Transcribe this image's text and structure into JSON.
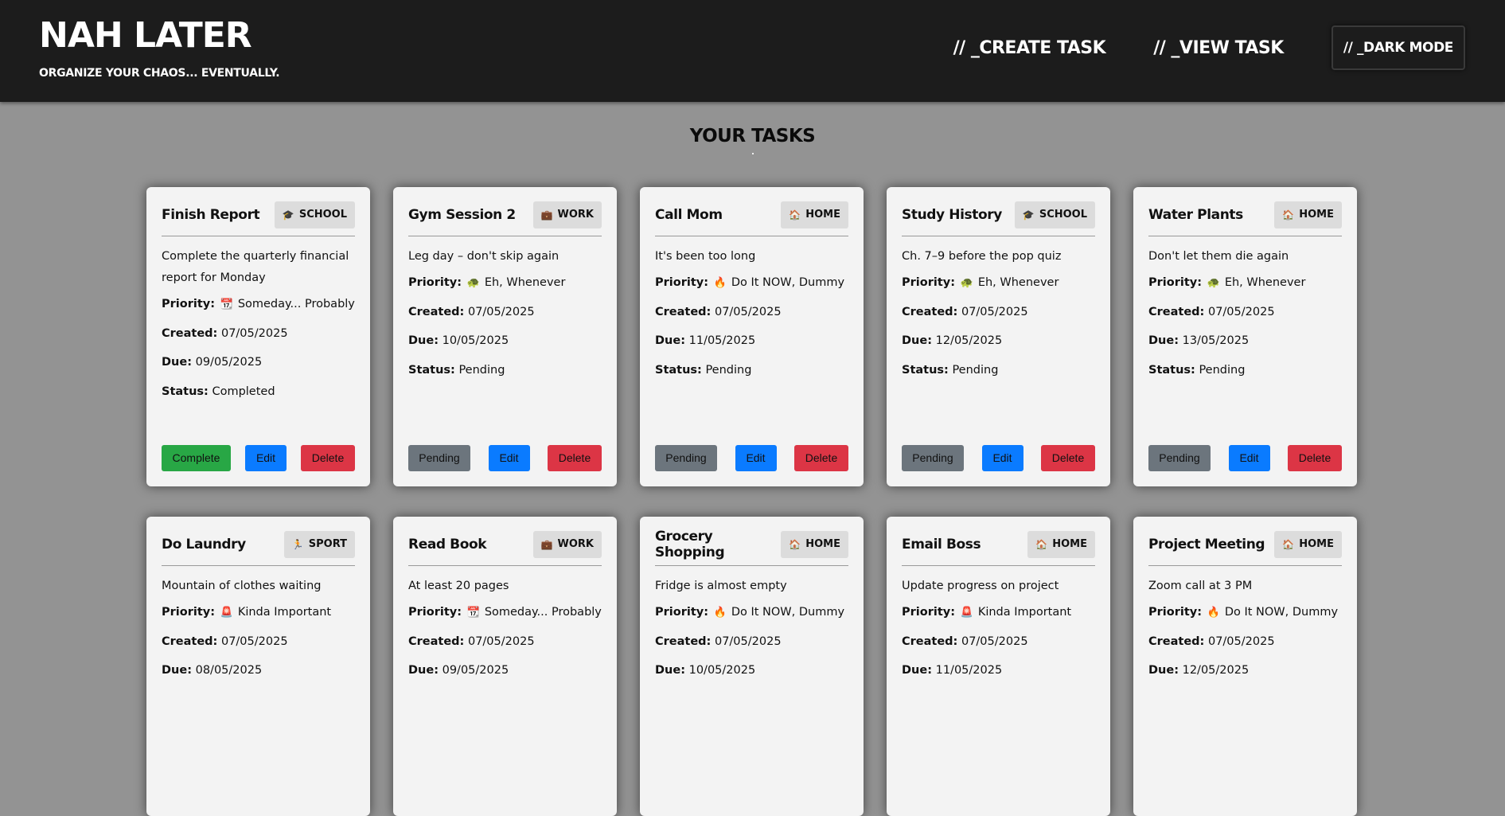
{
  "header": {
    "title": "NAH LATER",
    "tagline": "ORGANIZE YOUR CHAOS... EVENTUALLY.",
    "nav": {
      "create": "// _CREATE TASK",
      "view": "// _VIEW TASK",
      "dark": "// _DARK MODE"
    }
  },
  "main": {
    "heading": "YOUR TASKS"
  },
  "labels": {
    "priority": "Priority:",
    "created": "Created:",
    "due": "Due:",
    "status": "Status:",
    "edit": "Edit",
    "delete": "Delete"
  },
  "tasks": [
    {
      "title": "Finish Report",
      "category": "SCHOOL",
      "category_icon": "🎓",
      "description": "Complete the quarterly financial report for Monday",
      "priority_icon": "📆",
      "priority": "Someday... Probably",
      "created": "07/05/2025",
      "due": "09/05/2025",
      "status": "Completed",
      "status_button": "Complete",
      "done": true
    },
    {
      "title": "Gym Session 2",
      "category": "WORK",
      "category_icon": "💼",
      "description": "Leg day – don't skip again",
      "priority_icon": "🐢",
      "priority": "Eh, Whenever",
      "created": "07/05/2025",
      "due": "10/05/2025",
      "status": "Pending",
      "status_button": "Pending",
      "done": false
    },
    {
      "title": "Call Mom",
      "category": "HOME",
      "category_icon": "🏠",
      "description": "It's been too long",
      "priority_icon": "🔥",
      "priority": "Do It NOW, Dummy",
      "created": "07/05/2025",
      "due": "11/05/2025",
      "status": "Pending",
      "status_button": "Pending",
      "done": false
    },
    {
      "title": "Study History",
      "category": "SCHOOL",
      "category_icon": "🎓",
      "description": "Ch. 7–9 before the pop quiz",
      "priority_icon": "🐢",
      "priority": "Eh, Whenever",
      "created": "07/05/2025",
      "due": "12/05/2025",
      "status": "Pending",
      "status_button": "Pending",
      "done": false
    },
    {
      "title": "Water Plants",
      "category": "HOME",
      "category_icon": "🏠",
      "description": "Don't let them die again",
      "priority_icon": "🐢",
      "priority": "Eh, Whenever",
      "created": "07/05/2025",
      "due": "13/05/2025",
      "status": "Pending",
      "status_button": "Pending",
      "done": false
    },
    {
      "title": "Do Laundry",
      "category": "SPORT",
      "category_icon": "🏃",
      "description": "Mountain of clothes waiting",
      "priority_icon": "🚨",
      "priority": "Kinda Important",
      "created": "07/05/2025",
      "due": "08/05/2025"
    },
    {
      "title": "Read Book",
      "category": "WORK",
      "category_icon": "💼",
      "description": "At least 20 pages",
      "priority_icon": "📆",
      "priority": "Someday... Probably",
      "created": "07/05/2025",
      "due": "09/05/2025"
    },
    {
      "title": "Grocery Shopping",
      "category": "HOME",
      "category_icon": "🏠",
      "description": "Fridge is almost empty",
      "priority_icon": "🔥",
      "priority": "Do It NOW, Dummy",
      "created": "07/05/2025",
      "due": "10/05/2025"
    },
    {
      "title": "Email Boss",
      "category": "HOME",
      "category_icon": "🏠",
      "description": "Update progress on project",
      "priority_icon": "🚨",
      "priority": "Kinda Important",
      "created": "07/05/2025",
      "due": "11/05/2025"
    },
    {
      "title": "Project Meeting",
      "category": "HOME",
      "category_icon": "🏠",
      "description": "Zoom call at 3 PM",
      "priority_icon": "🔥",
      "priority": "Do It NOW, Dummy",
      "created": "07/05/2025",
      "due": "12/05/2025"
    }
  ]
}
